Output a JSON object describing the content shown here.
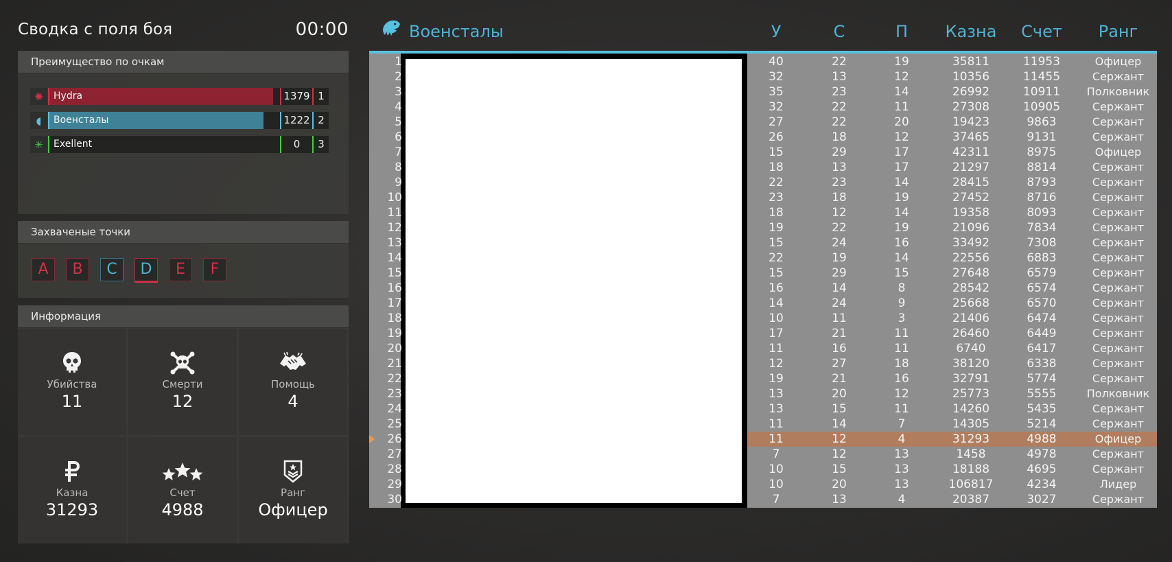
{
  "summary": {
    "title": "Сводка с поля боя",
    "timer": "00:00"
  },
  "score_panel": {
    "title": "Преимущество по очкам",
    "teams": [
      {
        "name": "Hydra",
        "score": "1379",
        "place": "1",
        "fill": 0.97,
        "color": "#8e2231",
        "accent": "#d33145",
        "icon": "hydra-icon"
      },
      {
        "name": "Военсталы",
        "score": "1222",
        "place": "2",
        "fill": 0.93,
        "color": "#3f8297",
        "accent": "#59c0df",
        "icon": "eagle-icon"
      },
      {
        "name": "Exellent",
        "score": "0",
        "place": "3",
        "fill": 0.0,
        "color": "#2d6b2d",
        "accent": "#3fcf3f",
        "icon": "clover-icon"
      }
    ]
  },
  "points_panel": {
    "title": "Захваченые точки",
    "points": [
      {
        "label": "A",
        "owner": "red"
      },
      {
        "label": "B",
        "owner": "red"
      },
      {
        "label": "C",
        "owner": "blue"
      },
      {
        "label": "D",
        "owner": "contested"
      },
      {
        "label": "E",
        "owner": "red"
      },
      {
        "label": "F",
        "owner": "red"
      }
    ]
  },
  "info_panel": {
    "title": "Информация",
    "kills": {
      "label": "Убийства",
      "value": "11",
      "icon": "skull-icon"
    },
    "deaths": {
      "label": "Смерти",
      "value": "12",
      "icon": "skull-crossbones-icon"
    },
    "assists": {
      "label": "Помощь",
      "value": "4",
      "icon": "handshake-icon"
    },
    "treasury": {
      "label": "Казна",
      "value": "31293",
      "icon": "ruble-icon"
    },
    "score": {
      "label": "Счет",
      "value": "4988",
      "icon": "stars-icon"
    },
    "rank": {
      "label": "Ранг",
      "value": "Офицер",
      "icon": "rank-chevron-icon"
    }
  },
  "scoreboard": {
    "team_title": "Военсталы",
    "columns": {
      "kills": "У",
      "deaths": "С",
      "assists": "П",
      "treasury": "Казна",
      "score": "Счет",
      "rank": "Ранг"
    },
    "highlight_row": 26,
    "rows": [
      {
        "n": "1",
        "k": "40",
        "d": "22",
        "a": "19",
        "m": "35811",
        "s": "11953",
        "r": "Офицер"
      },
      {
        "n": "2",
        "k": "32",
        "d": "13",
        "a": "12",
        "m": "10356",
        "s": "11455",
        "r": "Сержант"
      },
      {
        "n": "3",
        "k": "35",
        "d": "23",
        "a": "14",
        "m": "26992",
        "s": "10911",
        "r": "Полковник"
      },
      {
        "n": "4",
        "k": "32",
        "d": "22",
        "a": "11",
        "m": "27308",
        "s": "10905",
        "r": "Сержант"
      },
      {
        "n": "5",
        "k": "27",
        "d": "22",
        "a": "20",
        "m": "19423",
        "s": "9863",
        "r": "Сержант"
      },
      {
        "n": "6",
        "k": "26",
        "d": "18",
        "a": "12",
        "m": "37465",
        "s": "9131",
        "r": "Сержант"
      },
      {
        "n": "7",
        "k": "15",
        "d": "29",
        "a": "17",
        "m": "42311",
        "s": "8975",
        "r": "Офицер"
      },
      {
        "n": "8",
        "k": "18",
        "d": "13",
        "a": "17",
        "m": "21297",
        "s": "8814",
        "r": "Сержант"
      },
      {
        "n": "9",
        "k": "22",
        "d": "23",
        "a": "14",
        "m": "28415",
        "s": "8793",
        "r": "Сержант"
      },
      {
        "n": "10",
        "k": "23",
        "d": "18",
        "a": "19",
        "m": "27452",
        "s": "8716",
        "r": "Сержант"
      },
      {
        "n": "11",
        "k": "18",
        "d": "12",
        "a": "14",
        "m": "19358",
        "s": "8093",
        "r": "Сержант"
      },
      {
        "n": "12",
        "k": "19",
        "d": "22",
        "a": "19",
        "m": "21096",
        "s": "7834",
        "r": "Сержант"
      },
      {
        "n": "13",
        "k": "15",
        "d": "24",
        "a": "16",
        "m": "33492",
        "s": "7308",
        "r": "Сержант"
      },
      {
        "n": "14",
        "k": "22",
        "d": "19",
        "a": "14",
        "m": "22556",
        "s": "6883",
        "r": "Сержант"
      },
      {
        "n": "15",
        "k": "15",
        "d": "29",
        "a": "15",
        "m": "27648",
        "s": "6579",
        "r": "Сержант"
      },
      {
        "n": "16",
        "k": "16",
        "d": "14",
        "a": "8",
        "m": "28542",
        "s": "6574",
        "r": "Сержант"
      },
      {
        "n": "17",
        "k": "14",
        "d": "24",
        "a": "9",
        "m": "25668",
        "s": "6570",
        "r": "Сержант"
      },
      {
        "n": "18",
        "k": "10",
        "d": "11",
        "a": "3",
        "m": "21406",
        "s": "6474",
        "r": "Сержант"
      },
      {
        "n": "19",
        "k": "17",
        "d": "21",
        "a": "11",
        "m": "26460",
        "s": "6449",
        "r": "Сержант"
      },
      {
        "n": "20",
        "k": "11",
        "d": "16",
        "a": "11",
        "m": "6740",
        "s": "6417",
        "r": "Сержант"
      },
      {
        "n": "21",
        "k": "12",
        "d": "27",
        "a": "18",
        "m": "38120",
        "s": "6338",
        "r": "Сержант"
      },
      {
        "n": "22",
        "k": "19",
        "d": "21",
        "a": "16",
        "m": "32791",
        "s": "5774",
        "r": "Сержант"
      },
      {
        "n": "23",
        "k": "13",
        "d": "20",
        "a": "12",
        "m": "25773",
        "s": "5555",
        "r": "Полковник"
      },
      {
        "n": "24",
        "k": "13",
        "d": "15",
        "a": "11",
        "m": "14260",
        "s": "5435",
        "r": "Сержант"
      },
      {
        "n": "25",
        "k": "11",
        "d": "14",
        "a": "7",
        "m": "14305",
        "s": "5214",
        "r": "Сержант"
      },
      {
        "n": "26",
        "k": "11",
        "d": "12",
        "a": "4",
        "m": "31293",
        "s": "4988",
        "r": "Офицер"
      },
      {
        "n": "27",
        "k": "7",
        "d": "12",
        "a": "13",
        "m": "1458",
        "s": "4978",
        "r": "Сержант"
      },
      {
        "n": "28",
        "k": "10",
        "d": "15",
        "a": "13",
        "m": "18188",
        "s": "4695",
        "r": "Сержант"
      },
      {
        "n": "29",
        "k": "10",
        "d": "20",
        "a": "13",
        "m": "106817",
        "s": "4234",
        "r": "Лидер"
      },
      {
        "n": "30",
        "k": "7",
        "d": "13",
        "a": "4",
        "m": "20387",
        "s": "3027",
        "r": "Сержант"
      }
    ]
  }
}
